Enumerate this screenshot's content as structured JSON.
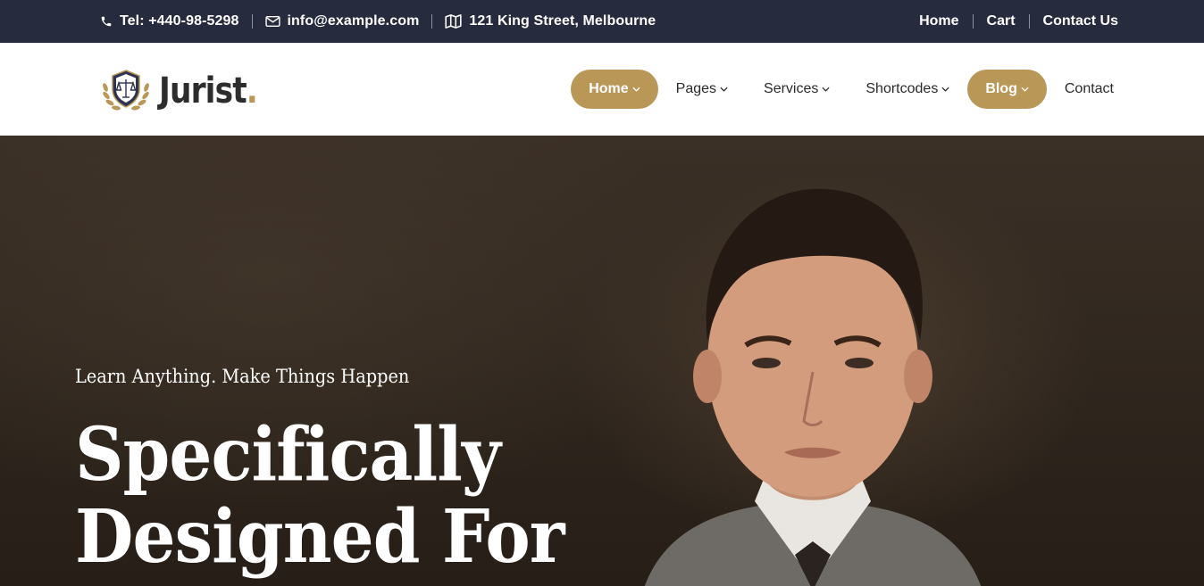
{
  "topbar": {
    "phone": "Tel: +440-98-5298",
    "email": "info@example.com",
    "address": "121 King Street, Melbourne",
    "links": [
      "Home",
      "Cart",
      "Contact Us"
    ]
  },
  "header": {
    "logo_text": "Jurist",
    "logo_dot": ".",
    "nav": [
      {
        "label": "Home",
        "dropdown": true,
        "active": true
      },
      {
        "label": "Pages",
        "dropdown": true,
        "active": false
      },
      {
        "label": "Services",
        "dropdown": true,
        "active": false
      },
      {
        "label": "Shortcodes",
        "dropdown": true,
        "active": false
      },
      {
        "label": "Blog",
        "dropdown": true,
        "active": true
      },
      {
        "label": "Contact",
        "dropdown": false,
        "active": false
      }
    ]
  },
  "hero": {
    "subtitle": "Learn Anything. Make Things Happen",
    "title_line1": "Specifically",
    "title_line2": "Designed For"
  },
  "colors": {
    "topbar_bg": "#272b3e",
    "accent": "#b99857",
    "text_dark": "#2a2a2a"
  },
  "icons": {
    "phone": "phone-icon",
    "email": "envelope-icon",
    "address": "map-icon",
    "logo": "scales-shield-laurel-icon",
    "dropdown": "chevron-down-icon"
  }
}
